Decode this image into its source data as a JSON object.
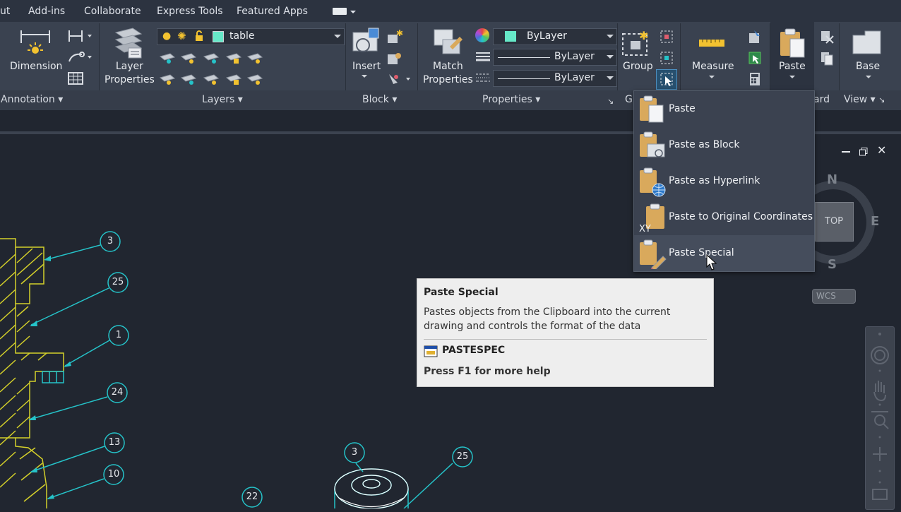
{
  "menubar": {
    "items": [
      "ut",
      "Add-ins",
      "Collaborate",
      "Express Tools",
      "Featured Apps"
    ]
  },
  "ribbon": {
    "annotation": {
      "dimension_label": "Dimension",
      "panel_title": "Annotation"
    },
    "layers": {
      "layer_properties_label": "Layer\nProperties",
      "layer_name": "table",
      "panel_title": "Layers"
    },
    "block": {
      "insert_label": "Insert",
      "panel_title": "Block"
    },
    "properties": {
      "match_label": "Match\nProperties",
      "color_value": "ByLayer",
      "linetype_value": "ByLayer",
      "lineweight_value": "ByLayer",
      "panel_title": "Properties"
    },
    "groups": {
      "group_label": "Group",
      "panel_title_partial": "G"
    },
    "utilities": {
      "measure_label": "Measure"
    },
    "clipboard": {
      "paste_label": "Paste",
      "panel_title_partial": "ard"
    },
    "view": {
      "base_label": "Base",
      "panel_title": "View"
    }
  },
  "paste_menu": {
    "items": [
      {
        "label": "Paste",
        "icon": "paste-icon"
      },
      {
        "label": "Paste as Block",
        "icon": "paste-block-icon"
      },
      {
        "label": "Paste as Hyperlink",
        "icon": "paste-hyperlink-icon"
      },
      {
        "label": "Paste to Original Coordinates",
        "icon": "paste-coordinates-icon"
      },
      {
        "label": "Paste Special",
        "icon": "paste-special-icon"
      }
    ],
    "hovered_index": 4
  },
  "tooltip": {
    "title": "Paste Special",
    "description": "Pastes objects from the Clipboard into the current drawing and controls the format of the data",
    "command": "PASTESPEC",
    "help": "Press F1 for more help"
  },
  "viewcube": {
    "north": "N",
    "east": "E",
    "south": "S",
    "face": "TOP",
    "ucs": "WCS"
  },
  "balloons": [
    "3",
    "25",
    "1",
    "24",
    "13",
    "10",
    "3",
    "25",
    "22"
  ],
  "colors": {
    "accent_cyan": "#25c3c9",
    "hatch_yellow": "#d4d02a",
    "clipboard_tan": "#d9a95c",
    "bylayer_swatch": "#66e8c8"
  }
}
